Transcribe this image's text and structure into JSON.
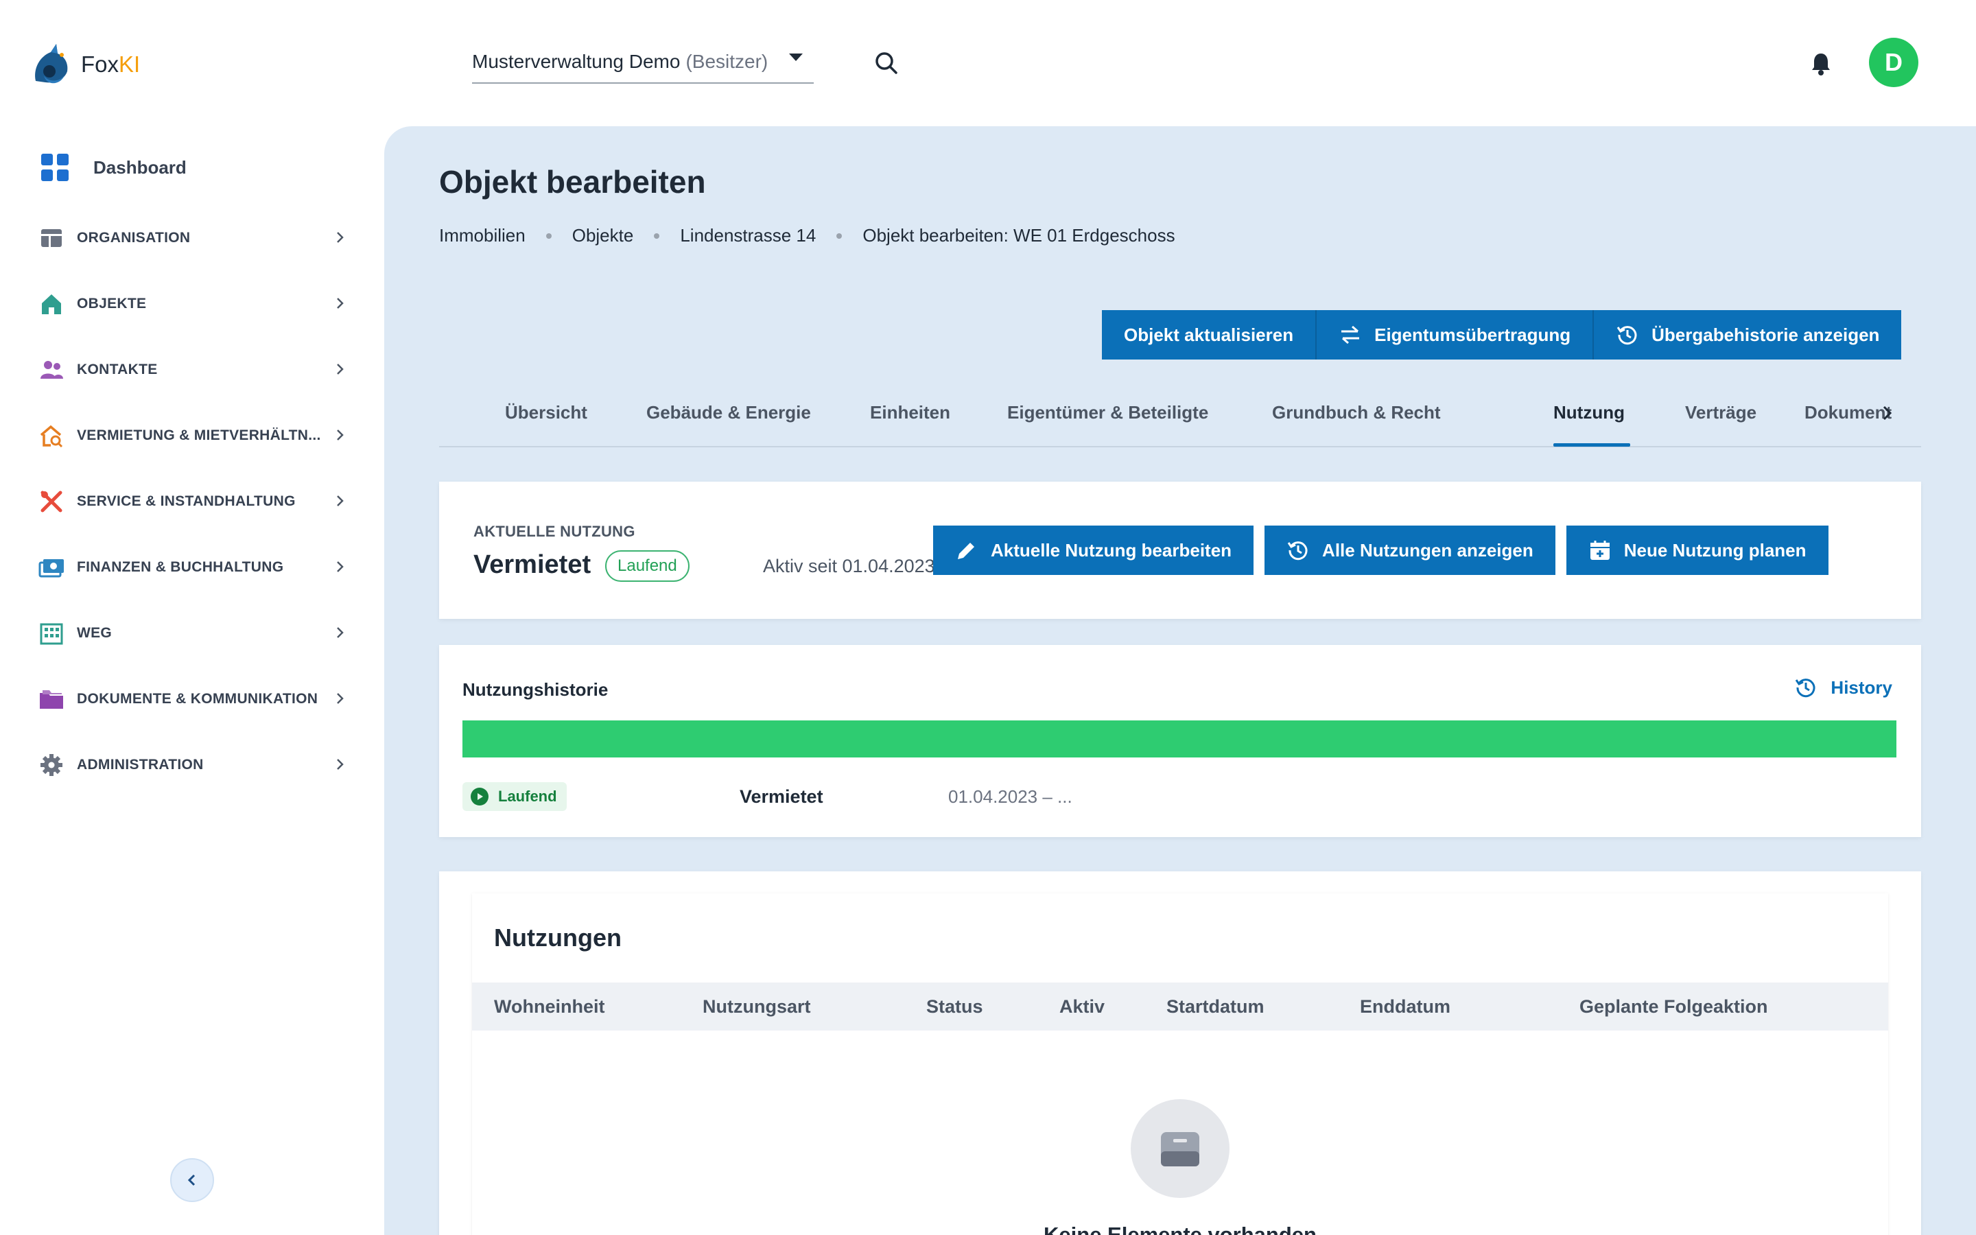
{
  "brand": {
    "name_prefix": "Fox",
    "name_suffix": "KI"
  },
  "header": {
    "tenant": "Musterverwaltung Demo",
    "tenant_role": "(Besitzer)",
    "avatar_initial": "D"
  },
  "sidebar": {
    "dashboard": "Dashboard",
    "items": [
      {
        "label": "ORGANISATION",
        "icon": "layout-icon",
        "color": "#6b7280"
      },
      {
        "label": "OBJEKTE",
        "icon": "home-icon",
        "color": "#2f9e8f"
      },
      {
        "label": "KONTAKTE",
        "icon": "people-icon",
        "color": "#9b59b6"
      },
      {
        "label": "VERMIETUNG & MIETVERHÄLTN...",
        "icon": "house-search-icon",
        "color": "#e67e22"
      },
      {
        "label": "SERVICE & INSTANDHALTUNG",
        "icon": "tools-icon",
        "color": "#e74c3c"
      },
      {
        "label": "FINANZEN & BUCHHALTUNG",
        "icon": "money-icon",
        "color": "#2e86c1"
      },
      {
        "label": "WEG",
        "icon": "building-icon",
        "color": "#2f9e8f"
      },
      {
        "label": "DOKUMENTE & KOMMUNIKATION",
        "icon": "folder-icon",
        "color": "#8e44ad"
      },
      {
        "label": "ADMINISTRATION",
        "icon": "gear-icon",
        "color": "#6b7280"
      }
    ]
  },
  "page": {
    "title": "Objekt bearbeiten",
    "breadcrumb": [
      "Immobilien",
      "Objekte",
      "Lindenstrasse 14",
      "Objekt bearbeiten: WE 01 Erdgeschoss"
    ],
    "actions": [
      "Objekt aktualisieren",
      "Eigentumsübertragung",
      "Übergabehistorie anzeigen"
    ],
    "tabs": [
      "Übersicht",
      "Gebäude & Energie",
      "Einheiten",
      "Eigentümer & Beteiligte",
      "Grundbuch & Recht",
      "Nutzung",
      "Verträge",
      "Dokument"
    ],
    "active_tab": "Nutzung"
  },
  "current_usage": {
    "label": "AKTUELLE NUTZUNG",
    "value": "Vermietet",
    "status": "Laufend",
    "since": "Aktiv seit 01.04.2023",
    "buttons": [
      "Aktuelle Nutzung bearbeiten",
      "Alle Nutzungen anzeigen",
      "Neue Nutzung planen"
    ]
  },
  "history": {
    "title": "Nutzungshistorie",
    "link": "History",
    "entry": {
      "status": "Laufend",
      "type": "Vermietet",
      "range": "01.04.2023 – ..."
    },
    "bar_color": "#2ecc71"
  },
  "usages": {
    "title": "Nutzungen",
    "columns": [
      "Wohneinheit",
      "Nutzungsart",
      "Status",
      "Aktiv",
      "Startdatum",
      "Enddatum",
      "Geplante Folgeaktion"
    ],
    "empty": "Keine Elemente vorhanden"
  },
  "colors": {
    "primary": "#0b70b8",
    "success": "#22c55e",
    "background": "#dde9f5"
  }
}
